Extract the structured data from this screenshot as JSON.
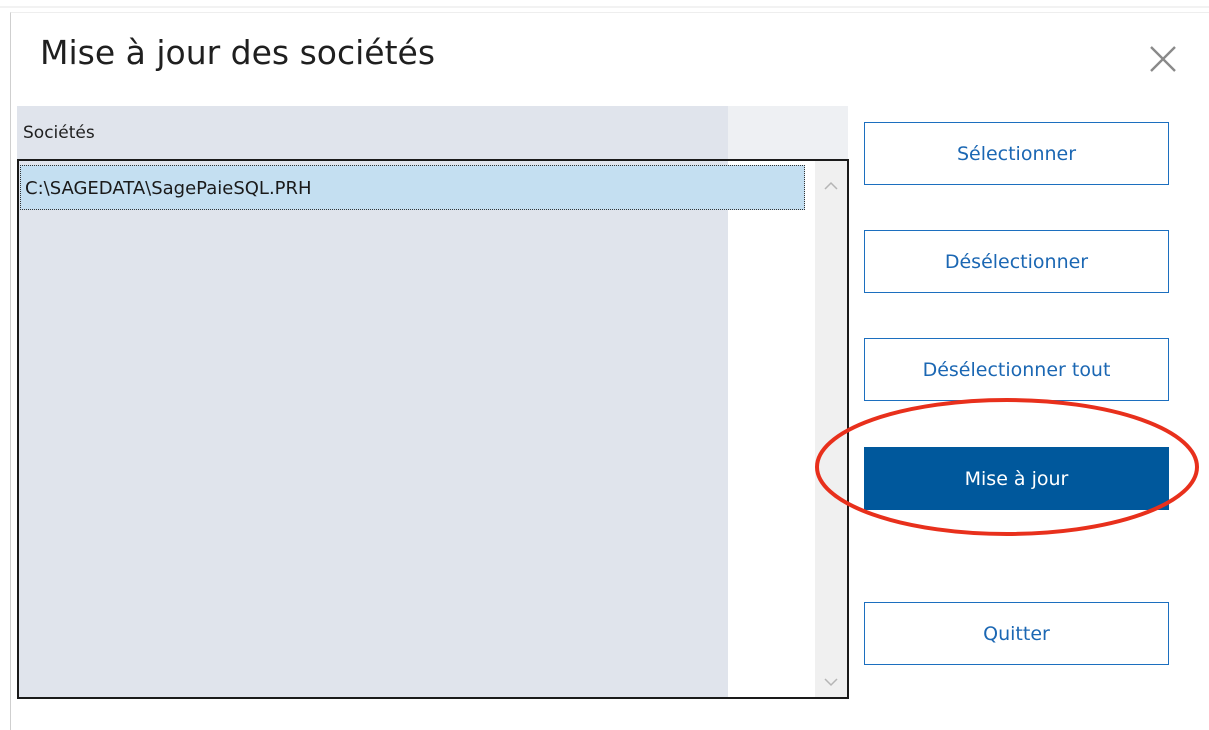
{
  "dialog": {
    "title": "Mise à jour des sociétés",
    "close_icon": "close-icon"
  },
  "companies": {
    "header": "Sociétés",
    "items": [
      {
        "path": "C:\\SAGEDATA\\SagePaieSQL.PRH",
        "selected": true
      }
    ]
  },
  "buttons": {
    "select": "Sélectionner",
    "deselect": "Désélectionner",
    "deselect_all": "Désélectionner tout",
    "update": "Mise à jour",
    "quit": "Quitter"
  },
  "colors": {
    "primary_button": "#00589c",
    "button_text": "#1b67b3",
    "selection": "#c4dff1",
    "annotation": "#e8301c"
  }
}
